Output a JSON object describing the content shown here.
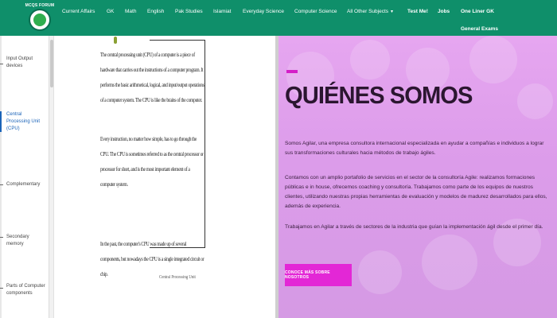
{
  "header": {
    "logo_text": "MCQS FORUM",
    "nav": [
      {
        "label": "Current Affairs"
      },
      {
        "label": "GK"
      },
      {
        "label": "Math"
      },
      {
        "label": "English"
      },
      {
        "label": "Pak Studies"
      },
      {
        "label": "Islamiat"
      },
      {
        "label": "Everyday Science"
      },
      {
        "label": "Computer Science"
      },
      {
        "label": "All Other Subjects"
      },
      {
        "label": "Test Me!"
      },
      {
        "label": "Jobs"
      },
      {
        "label": "One Liner GK"
      },
      {
        "label": "General Exams"
      }
    ]
  },
  "sidebar": {
    "items": [
      {
        "label": "Input Output devices"
      },
      {
        "label": "Central Processing Unit (CPU)"
      },
      {
        "label": "Complementary"
      },
      {
        "label": "Secondary memory"
      },
      {
        "label": "Parts of Computer components"
      }
    ]
  },
  "document": {
    "paragraphs": [
      "The central processing unit (CPU) of a computer is a piece of hardware that carries out the instructions of a computer program. It performs the basic arithmetical, logical, and input/output operations of a computer system. The CPU is like the brains of the computer.",
      "Every instruction, no matter how simple, has to go through the CPU. The CPU is sometimes referred to as the central processor or processor for short, and is the most important element of a computer system.",
      "In the past, the computer's CPU was made up of several components, but nowadays the CPU is a single integrated circuit or chip."
    ],
    "signature": "Central Processing Unit"
  },
  "hero": {
    "title": "QUIÉNES SOMOS",
    "paragraphs": [
      "Somos Agilar, una empresa consultora internacional especializada en ayudar a compañías e individuos a lograr sus transformaciones culturales hacia métodos de trabajo ágiles.",
      "Contamos con un amplio portafolio de servicios en el sector de la consultoría Agile: realizamos formaciones públicas e in house, ofrecemos coaching y consultoría. Trabajamos como parte de los equipos de nuestros clientes, utilizando nuestras propias herramientas de evaluación y modelos de madurez desarrollados para ellos, además de experiencia.",
      "Trabajamos en Agilar a través de sectores de la industria que guían la implementación ágil desde el primer día."
    ],
    "button_label": "CONOCE MÁS SOBRE NOSOTROS",
    "accent_color": "#d41fc8",
    "button_color": "#e327d6"
  },
  "colors": {
    "nav_bg": "#0f8f6a",
    "hero_bg": "#e3a3ee"
  }
}
